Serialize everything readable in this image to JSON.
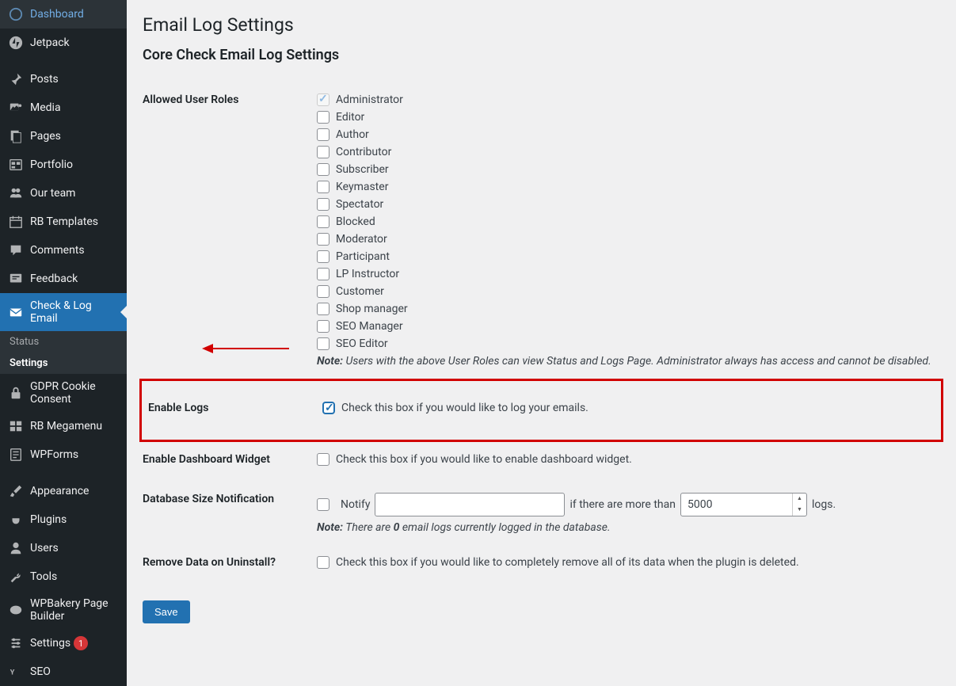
{
  "sidebar": {
    "items": [
      {
        "label": "Dashboard",
        "icon": "dashboard"
      },
      {
        "label": "Jetpack",
        "icon": "jetpack"
      },
      {
        "label": "Posts",
        "icon": "pin"
      },
      {
        "label": "Media",
        "icon": "media"
      },
      {
        "label": "Pages",
        "icon": "page"
      },
      {
        "label": "Portfolio",
        "icon": "portfolio"
      },
      {
        "label": "Our team",
        "icon": "team"
      },
      {
        "label": "RB Templates",
        "icon": "calendar"
      },
      {
        "label": "Comments",
        "icon": "comment"
      },
      {
        "label": "Feedback",
        "icon": "feedback"
      },
      {
        "label": "Check & Log Email",
        "icon": "mail",
        "active": true
      },
      {
        "label": "GDPR Cookie Consent",
        "icon": "lock"
      },
      {
        "label": "RB Megamenu",
        "icon": "menu"
      },
      {
        "label": "WPForms",
        "icon": "forms"
      },
      {
        "label": "Appearance",
        "icon": "brush"
      },
      {
        "label": "Plugins",
        "icon": "plug"
      },
      {
        "label": "Users",
        "icon": "user"
      },
      {
        "label": "Tools",
        "icon": "wrench"
      },
      {
        "label": "WPBakery Page Builder",
        "icon": "wpb"
      },
      {
        "label": "Settings",
        "icon": "settings",
        "badge": "1"
      },
      {
        "label": "SEO",
        "icon": "seo"
      }
    ],
    "sub": {
      "status": "Status",
      "settings": "Settings"
    }
  },
  "page": {
    "title": "Email Log Settings",
    "subtitle": "Core Check Email Log Settings"
  },
  "allowed_roles": {
    "label": "Allowed User Roles",
    "roles": [
      "Administrator",
      "Editor",
      "Author",
      "Contributor",
      "Subscriber",
      "Keymaster",
      "Spectator",
      "Blocked",
      "Moderator",
      "Participant",
      "LP Instructor",
      "Customer",
      "Shop manager",
      "SEO Manager",
      "SEO Editor"
    ],
    "note_label": "Note:",
    "note": " Users with the above User Roles can view Status and Logs Page. Administrator always has access and cannot be disabled."
  },
  "enable_logs": {
    "label": "Enable Logs",
    "desc": "Check this box if you would like to log your emails."
  },
  "dashboard_widget": {
    "label": "Enable Dashboard Widget",
    "desc": "Check this box if you would like to enable dashboard widget."
  },
  "db_notify": {
    "label": "Database Size Notification",
    "notify": "Notify",
    "more_than": "if there are more than",
    "value": "5000",
    "suffix": "logs.",
    "note_label": "Note:",
    "note_pre": " There are ",
    "count": "0",
    "note_post": " email logs currently logged in the database."
  },
  "remove_data": {
    "label": "Remove Data on Uninstall?",
    "desc": "Check this box if you would like to completely remove all of its data when the plugin is deleted."
  },
  "save_label": "Save"
}
